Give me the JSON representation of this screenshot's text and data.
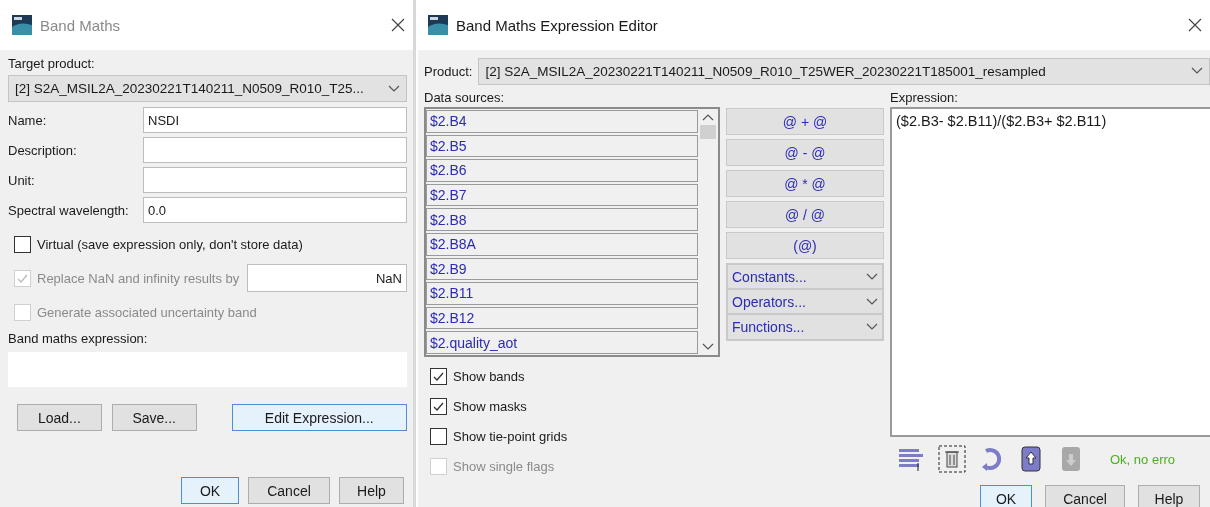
{
  "band_maths": {
    "title": "Band Maths",
    "target_product_label": "Target product:",
    "target_product": "[2] S2A_MSIL2A_20230221T140211_N0509_R010_T25...",
    "fields": [
      {
        "label": "Name:",
        "value": "NSDI"
      },
      {
        "label": "Description:"
      },
      {
        "label": "Unit:"
      },
      {
        "label": "Spectral wavelength:",
        "value": "0.0"
      }
    ],
    "options": [
      {
        "kind": "plain",
        "label": "Virtual (save expression only, don't store data)",
        "checked": false,
        "disabled": false
      },
      {
        "kind": "with_field",
        "label": "Replace NaN and infinity results by",
        "checked": true,
        "disabled": true,
        "value": "NaN"
      },
      {
        "kind": "plain",
        "label": "Generate associated uncertainty band",
        "checked": false,
        "disabled": true
      }
    ],
    "expression_label": "Band maths expression:",
    "actions": [
      {
        "label": "Load...",
        "selected": false
      },
      {
        "label": "Save...",
        "selected": false
      },
      {
        "label": "Edit Expression...",
        "selected": true
      }
    ],
    "buttons": [
      {
        "label": "OK",
        "selected": true
      },
      {
        "label": "Cancel",
        "selected": false
      },
      {
        "label": "Help",
        "selected": false
      }
    ]
  },
  "editor": {
    "title": "Band Maths Expression Editor",
    "product_label": "Product:",
    "product": "[2] S2A_MSIL2A_20230221T140211_N0509_R010_T25WER_20230221T185001_resampled",
    "data_sources_label": "Data sources:",
    "data_sources": [
      "$2.B4",
      "$2.B5",
      "$2.B6",
      "$2.B7",
      "$2.B8",
      "$2.B8A",
      "$2.B9",
      "$2.B11",
      "$2.B12",
      "$2.quality_aot"
    ],
    "operator_buttons": [
      "@ + @",
      "@ - @",
      "@ * @",
      "@ / @",
      "(@)"
    ],
    "menus": [
      "Constants...",
      "Operators...",
      "Functions..."
    ],
    "show_options": [
      {
        "label": "Show bands",
        "checked": true,
        "disabled": false
      },
      {
        "label": "Show masks",
        "checked": true,
        "disabled": false
      },
      {
        "label": "Show tie-point grids",
        "checked": false,
        "disabled": false
      },
      {
        "label": "Show single flags",
        "checked": false,
        "disabled": true
      }
    ],
    "expression_label": "Expression:",
    "expression": "($2.B3- $2.B11)/($2.B3+ $2.B11)",
    "tools": [
      {
        "kind": "code",
        "disabled": false
      },
      {
        "kind": "delete",
        "disabled": false
      },
      {
        "kind": "undo",
        "disabled": false
      },
      {
        "kind": "export",
        "disabled": false
      },
      {
        "kind": "import",
        "disabled": true
      }
    ],
    "status": "Ok, no erro",
    "buttons": [
      {
        "label": "OK",
        "selected": true
      },
      {
        "label": "Cancel",
        "selected": false
      },
      {
        "label": "Help",
        "selected": false
      }
    ]
  }
}
